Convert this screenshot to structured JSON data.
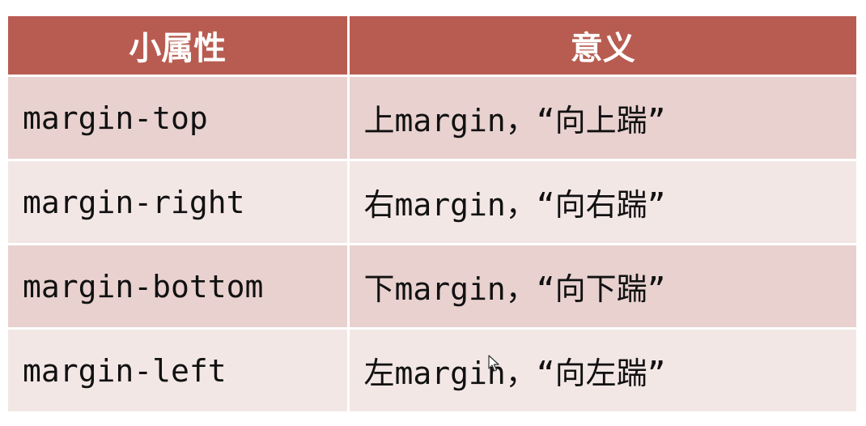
{
  "table": {
    "headers": [
      "小属性",
      "意义"
    ],
    "rows": [
      {
        "property": "margin-top",
        "meaning": "上margin，“向上踹”"
      },
      {
        "property": "margin-right",
        "meaning": "右margin，“向右踹”"
      },
      {
        "property": "margin-bottom",
        "meaning": "下margin，“向下踹”"
      },
      {
        "property": "margin-left",
        "meaning": "左margin，“向左踹”"
      }
    ]
  },
  "colors": {
    "header_bg": "#b85c51",
    "row_odd_bg": "#e8d1cf",
    "row_even_bg": "#f3e7e6"
  },
  "icons": [
    "mouse-cursor-icon"
  ]
}
